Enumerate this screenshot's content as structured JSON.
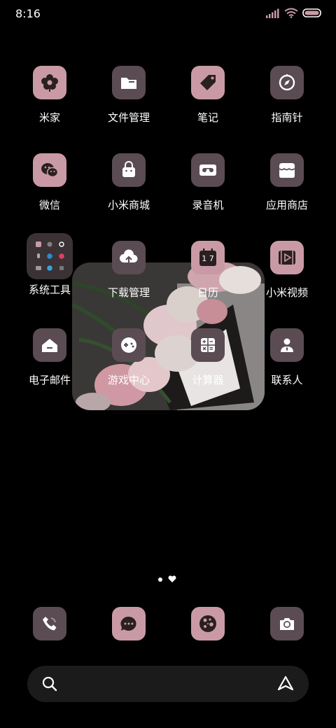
{
  "status_bar": {
    "time": "8:16"
  },
  "apps": [
    {
      "label": "米家",
      "icon": "flower-icon",
      "style": "pink"
    },
    {
      "label": "文件管理",
      "icon": "folder-icon",
      "style": "mauve"
    },
    {
      "label": "笔记",
      "icon": "tag-icon",
      "style": "pink"
    },
    {
      "label": "指南针",
      "icon": "compass-icon",
      "style": "mauve"
    },
    {
      "label": "微信",
      "icon": "wechat-icon",
      "style": "pink"
    },
    {
      "label": "小米商城",
      "icon": "shopping-bag-icon",
      "style": "mauve"
    },
    {
      "label": "录音机",
      "icon": "cassette-icon",
      "style": "mauve"
    },
    {
      "label": "应用商店",
      "icon": "store-icon",
      "style": "mauve"
    },
    {
      "label": "系统工具",
      "icon": "folder-grid-icon",
      "style": "folder"
    },
    {
      "label": "下载管理",
      "icon": "cloud-download-icon",
      "style": "mauve"
    },
    {
      "label": "日历",
      "icon": "calendar-icon",
      "style": "pink",
      "badge_text": "1 7"
    },
    {
      "label": "小米视频",
      "icon": "play-icon",
      "style": "pink"
    },
    {
      "label": "电子邮件",
      "icon": "mail-icon",
      "style": "mauve"
    },
    {
      "label": "游戏中心",
      "icon": "gamepad-icon",
      "style": "mauve"
    },
    {
      "label": "计算器",
      "icon": "calculator-icon",
      "style": "mauve"
    },
    {
      "label": "联系人",
      "icon": "contact-icon",
      "style": "mauve"
    }
  ],
  "dock": [
    {
      "icon": "phone-icon",
      "style": "mauve"
    },
    {
      "icon": "message-icon",
      "style": "pink"
    },
    {
      "icon": "theme-palette-icon",
      "style": "pink"
    },
    {
      "icon": "camera-icon",
      "style": "mauve"
    }
  ],
  "page_indicator": {
    "pages": 2,
    "current": 1
  },
  "search": {
    "left_icon": "search-icon",
    "right_icon": "assistant-icon"
  },
  "colors": {
    "pink": "#c99aa5",
    "mauve": "#5a4c52",
    "background": "#000000"
  }
}
